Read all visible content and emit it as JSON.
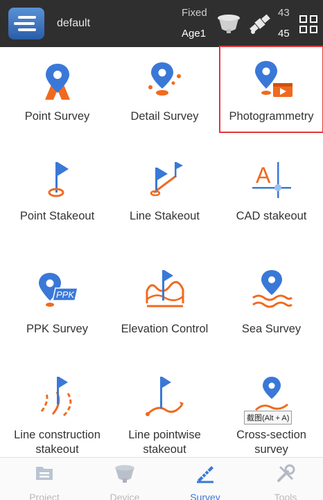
{
  "status_bar": {
    "profile_name": "default",
    "fix_status": "Fixed",
    "age_status": "Age1",
    "sat_count_top": "43",
    "sat_count_bottom": "45",
    "icons": [
      "app-logo",
      "receiver-icon",
      "satellite-icon",
      "grid-menu-icon"
    ]
  },
  "tiles": [
    {
      "label": "Point Survey",
      "icon": "point-survey-icon"
    },
    {
      "label": "Detail Survey",
      "icon": "detail-survey-icon"
    },
    {
      "label": "Photogrammetry",
      "icon": "photogrammetry-icon",
      "selected": true
    },
    {
      "label": "Point Stakeout",
      "icon": "point-stakeout-icon"
    },
    {
      "label": "Line Stakeout",
      "icon": "line-stakeout-icon"
    },
    {
      "label": "CAD stakeout",
      "icon": "cad-stakeout-icon"
    },
    {
      "label": "PPK Survey",
      "icon": "ppk-survey-icon",
      "badge": "PPK"
    },
    {
      "label": "Elevation Control",
      "icon": "elevation-control-icon"
    },
    {
      "label": "Sea Survey",
      "icon": "sea-survey-icon"
    },
    {
      "label_line1": "Line construction",
      "label_line2": "stakeout",
      "icon": "line-construction-stakeout-icon"
    },
    {
      "label_line1": "Line pointwise",
      "label_line2": "stakeout",
      "icon": "line-pointwise-stakeout-icon"
    },
    {
      "label_line1": "Cross-section",
      "label_line2": "survey",
      "icon": "cross-section-survey-icon"
    }
  ],
  "tooltip": "截图(Alt + A)",
  "bottom_nav": [
    {
      "label": "Project",
      "icon": "project-icon"
    },
    {
      "label": "Device",
      "icon": "device-icon"
    },
    {
      "label": "Survey",
      "icon": "survey-icon",
      "active": true
    },
    {
      "label": "Tools",
      "icon": "tools-icon"
    }
  ],
  "colors": {
    "accent_blue": "#3a78d8",
    "accent_orange": "#f06a1e",
    "status_bar": "#2f2f2f",
    "selection_border": "#e2363a"
  }
}
